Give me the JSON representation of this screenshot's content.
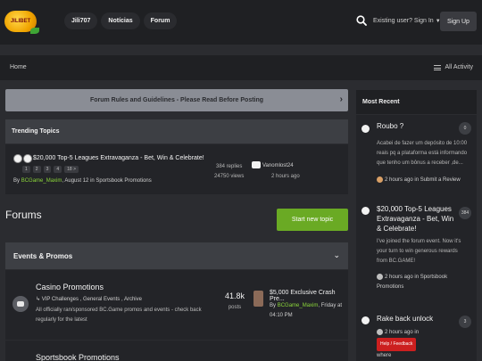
{
  "header": {
    "logo_text": "JILIBET",
    "nav": [
      "Jili707",
      "Notícias",
      "Forum"
    ],
    "signin": "Existing user? Sign In",
    "signup": "Sign Up"
  },
  "breadcrumb": {
    "home": "Home",
    "all_activity": "All Activity"
  },
  "rules_banner": "Forum Rules and Guidelines - Please Read Before Posting",
  "trending": {
    "title": "Trending Topics",
    "topic": {
      "title": "$20,000 Top-5 Leagues Extravaganza - Bet, Win & Celebrate!",
      "pages": [
        "1",
        "2",
        "3",
        "4",
        "18 >"
      ],
      "by_prefix": "By",
      "author": "BCGame_Maxim",
      "meta_suffix": ", August 12 in Sportsbook Promotions",
      "replies": "384 replies",
      "views": "24750 views",
      "last_user": "Vanomlost24",
      "last_time": "2 hours ago"
    }
  },
  "forums": {
    "title": "Forums",
    "start_topic": "Start new topic",
    "category": "Events & Promos",
    "rows": [
      {
        "title": "Casino Promotions",
        "subforums": "↳ VIP Challenges ,  General Events ,  Archive",
        "description": "All officially ran/sponsored BC.Game promos and events - check back regularly for the latest",
        "count": "41.8k",
        "count_label": "posts",
        "last_title": "$5,000 Exclusive Crash Pre...",
        "last_by": "By",
        "last_author": "BCGame_Maxim",
        "last_time": ", Friday at 04:10 PM"
      },
      {
        "title": "Sportsbook Promotions"
      }
    ]
  },
  "sidebar": {
    "title": "Most Recent",
    "items": [
      {
        "title": "Roubo ?",
        "count": "0",
        "excerpt": "Acabei de fazer um depósito de 10:00 reais pq a plataforma está informando que tenho um bônus a receber ,de...",
        "time": "2 hours ago",
        "in": "in Submit a Review"
      },
      {
        "title": "$20,000 Top-5 Leagues Extravaganza - Bet, Win & Celebrate!",
        "count": "384",
        "excerpt": "I've joined the forum event. Now it's your turn to win generous rewards from BC.GAME!",
        "time": "2 hours ago",
        "in": "in Sportsbook Promotions"
      },
      {
        "title": "Rake back unlock",
        "count": "3",
        "time": "2 hours ago",
        "in": "in",
        "tag": "Help / Feedback",
        "tail": "where"
      }
    ]
  }
}
